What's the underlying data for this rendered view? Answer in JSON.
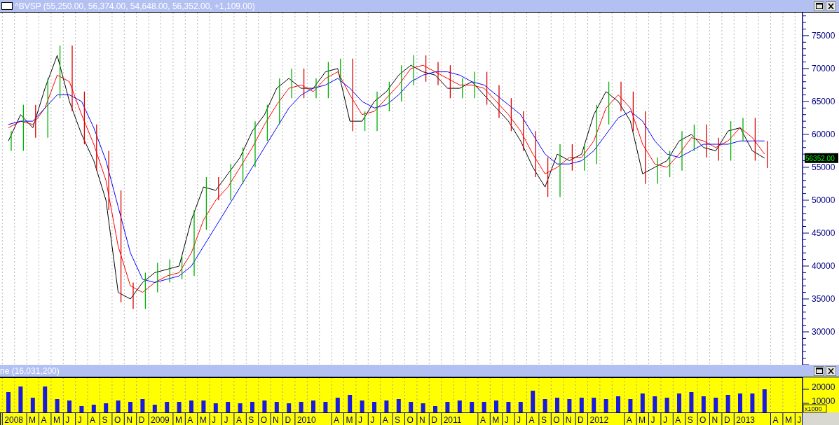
{
  "price_window": {
    "title": "^BVSP (55,250.00, 56,374.00, 54,648.00, 56,352.00, +1,109.00)",
    "last_price": "56352.00",
    "chart_data": {
      "type": "line",
      "ylim": [
        25000,
        78500
      ],
      "yticks": [
        30000,
        35000,
        40000,
        45000,
        50000,
        55000,
        60000,
        65000,
        70000,
        75000
      ],
      "series": [
        {
          "color": "#000000",
          "values": [
            59000,
            63000,
            61000,
            67000,
            72000,
            65000,
            60000,
            56000,
            50000,
            36000,
            35000,
            37500,
            39000,
            39500,
            40000,
            47000,
            52000,
            51500,
            54000,
            56500,
            60500,
            63000,
            67000,
            68500,
            67000,
            67000,
            69500,
            70000,
            62000,
            62000,
            65000,
            66500,
            69000,
            70500,
            69500,
            69000,
            67000,
            67000,
            68000,
            66000,
            64000,
            62000,
            59000,
            55000,
            52000,
            57000,
            56000,
            57000,
            63000,
            66500,
            65000,
            62000,
            54000,
            55000,
            56000,
            59000,
            60000,
            58000,
            57500,
            60500,
            61000,
            57500,
            56400
          ]
        },
        {
          "color": "#ff0000",
          "values": [
            61000,
            62000,
            61500,
            64000,
            69000,
            68000,
            63000,
            58500,
            53000,
            43000,
            37000,
            36000,
            37500,
            38500,
            39000,
            42000,
            47000,
            50000,
            52000,
            55000,
            58000,
            61500,
            64500,
            67000,
            67500,
            66500,
            68500,
            69500,
            66000,
            63000,
            63500,
            65500,
            67500,
            70000,
            70500,
            69500,
            68500,
            67500,
            67500,
            67000,
            65000,
            63000,
            60500,
            57000,
            54000,
            55000,
            56500,
            56500,
            59000,
            64000,
            66000,
            64000,
            58500,
            55500,
            55000,
            57000,
            59500,
            59000,
            58000,
            59000,
            61000,
            59500,
            57000
          ]
        },
        {
          "color": "#0000ff",
          "values": [
            61500,
            62000,
            62000,
            64000,
            66000,
            66000,
            65000,
            61000,
            56000,
            49000,
            42000,
            38000,
            37500,
            38000,
            38500,
            40000,
            43000,
            46000,
            49000,
            52000,
            55000,
            58000,
            61000,
            64000,
            66000,
            67000,
            67500,
            68500,
            67000,
            65000,
            64000,
            64500,
            66000,
            68000,
            69000,
            69500,
            69500,
            69000,
            68000,
            67500,
            66000,
            64500,
            63000,
            60000,
            57000,
            55500,
            55500,
            56000,
            57500,
            60000,
            62500,
            63500,
            62000,
            59000,
            57000,
            56500,
            57500,
            58500,
            58500,
            58500,
            59000,
            59000,
            59000
          ]
        }
      ]
    }
  },
  "volume_window": {
    "title": "ne (16,031,200)",
    "unit_label": "x1000",
    "chart_data": {
      "type": "bar",
      "ylim": [
        3500,
        28500
      ],
      "yticks": [
        {
          "value": 10000,
          "label": "10000"
        },
        {
          "value": 20000,
          "label": "20000"
        }
      ],
      "categories": [
        null,
        "2008",
        null,
        "M",
        "A",
        "M",
        "J",
        "J",
        "A",
        "S",
        "O",
        "N",
        "D",
        "2009",
        null,
        "M",
        "A",
        "M",
        "J",
        "J",
        "A",
        "S",
        "O",
        "N",
        "D",
        "2010",
        null,
        null,
        "A",
        "M",
        "J",
        "J",
        "A",
        "S",
        "O",
        "N",
        "D",
        "2011",
        null,
        null,
        "A",
        "M",
        "J",
        "J",
        "A",
        "S",
        "O",
        "N",
        "D",
        "2012",
        null,
        null,
        "A",
        "M",
        "J",
        "J",
        "A",
        "S",
        "O",
        "N",
        "D",
        "2013",
        null,
        null,
        "A",
        "M",
        "J"
      ],
      "values": [
        null,
        18000,
        22000,
        14000,
        22000,
        13000,
        12000,
        8000,
        9000,
        10000,
        12000,
        11000,
        13000,
        9000,
        11000,
        11000,
        12000,
        12000,
        10000,
        11000,
        10000,
        11000,
        12000,
        11000,
        10000,
        11000,
        12000,
        11000,
        14000,
        16000,
        12000,
        11000,
        12000,
        13000,
        11000,
        10000,
        8000,
        11000,
        12000,
        11000,
        11000,
        12000,
        11000,
        11000,
        19000,
        13000,
        14000,
        13000,
        14000,
        14000,
        13000,
        15000,
        13000,
        17000,
        15000,
        14000,
        17000,
        18000,
        15000,
        14000,
        16000,
        17000,
        17000,
        20000,
        null,
        null,
        null
      ]
    }
  }
}
